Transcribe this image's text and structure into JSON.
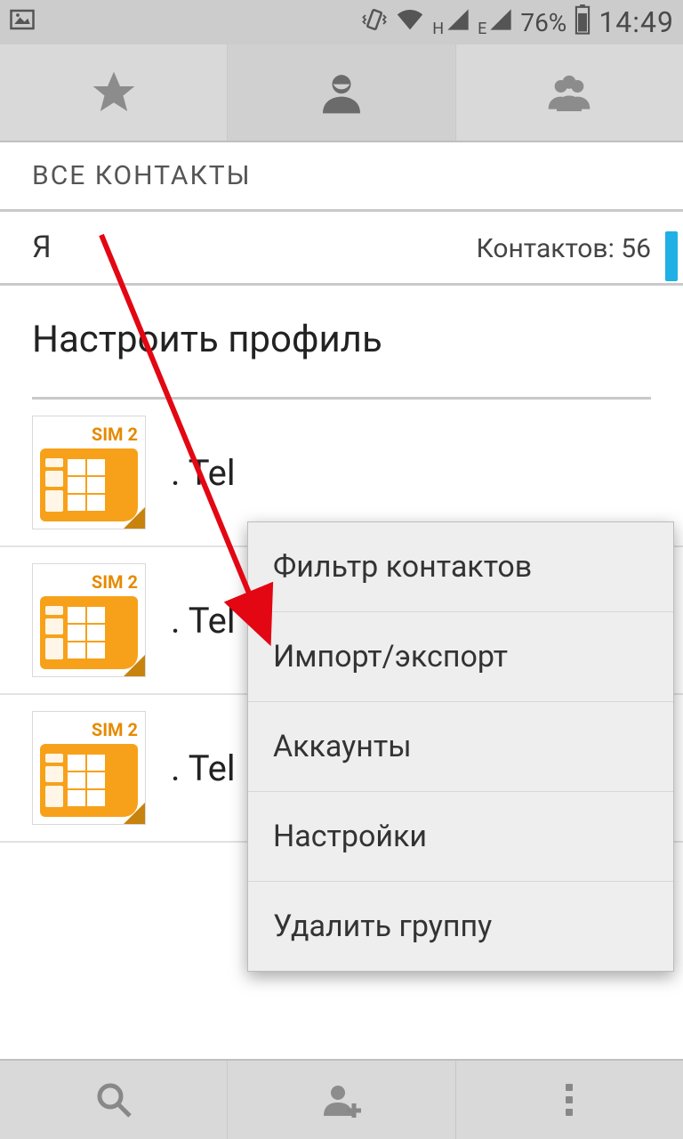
{
  "status_bar": {
    "network_h_label": "H",
    "network_e_label": "E",
    "battery_text": "76%",
    "time": "14:49"
  },
  "section_header": "ВСЕ КОНТАКТЫ",
  "me_row": {
    "me_label": "Я",
    "count_label": "Контактов: 56"
  },
  "profile_link": "Настроить профиль",
  "sim_label": "SIM 2",
  "contacts": [
    {
      "name": ". Tel"
    },
    {
      "name": ". Tel"
    },
    {
      "name": ". Tel"
    }
  ],
  "popup_menu": [
    "Фильтр контактов",
    "Импорт/экспорт",
    "Аккаунты",
    "Настройки",
    "Удалить группу"
  ]
}
